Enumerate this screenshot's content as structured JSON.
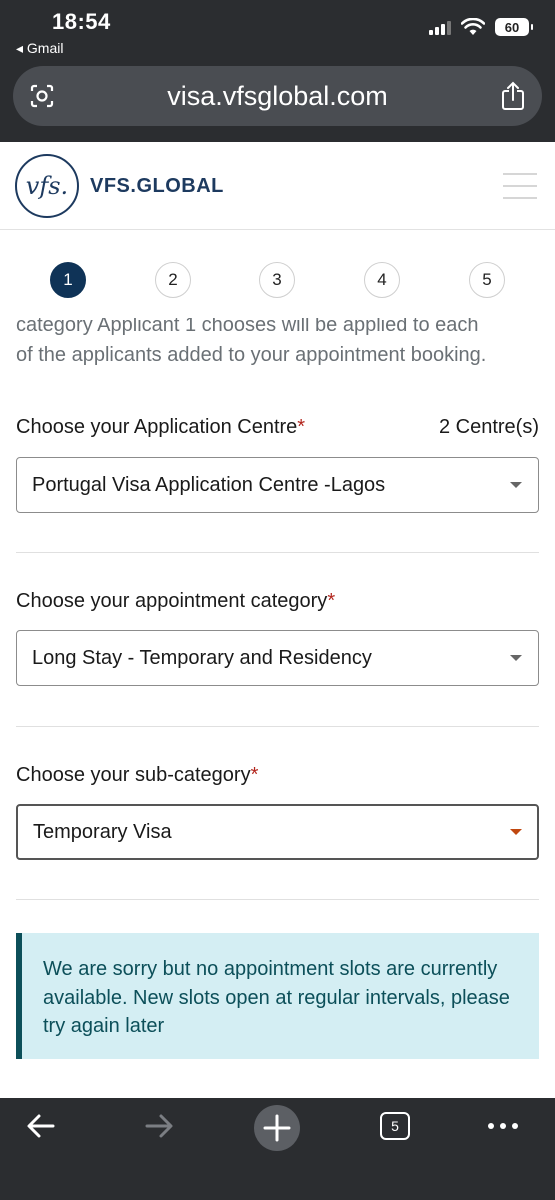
{
  "status": {
    "time": "18:54",
    "back_label": "◂ Gmail",
    "battery": "60"
  },
  "browser": {
    "url": "visa.vfsglobal.com",
    "tab_count": "5"
  },
  "header": {
    "logo_mark": "vfs.",
    "logo_text": "VFS.GLOBAL"
  },
  "stepper": [
    "1",
    "2",
    "3",
    "4",
    "5"
  ],
  "form": {
    "intro_line1": "category Applicant 1 chooses will be applied to each",
    "intro_line2": "of the applicants added to your appointment booking.",
    "centre": {
      "label": "Choose your Application Centre",
      "count": "2 Centre(s)",
      "value": "Portugal Visa Application Centre -Lagos"
    },
    "category": {
      "label": "Choose your appointment category",
      "value": "Long Stay - Temporary and Residency"
    },
    "subcategory": {
      "label": "Choose your sub-category",
      "value": "Temporary Visa"
    },
    "required_mark": "*"
  },
  "alert": {
    "message": "We are sorry but no appointment slots are currently available. New slots open at regular intervals, please try again later"
  },
  "colors": {
    "brand": "#1d3a5f",
    "active_step": "#0f3357",
    "alert_bg": "#d4eef3",
    "alert_text": "#0c4f59",
    "required": "#b3261e"
  }
}
